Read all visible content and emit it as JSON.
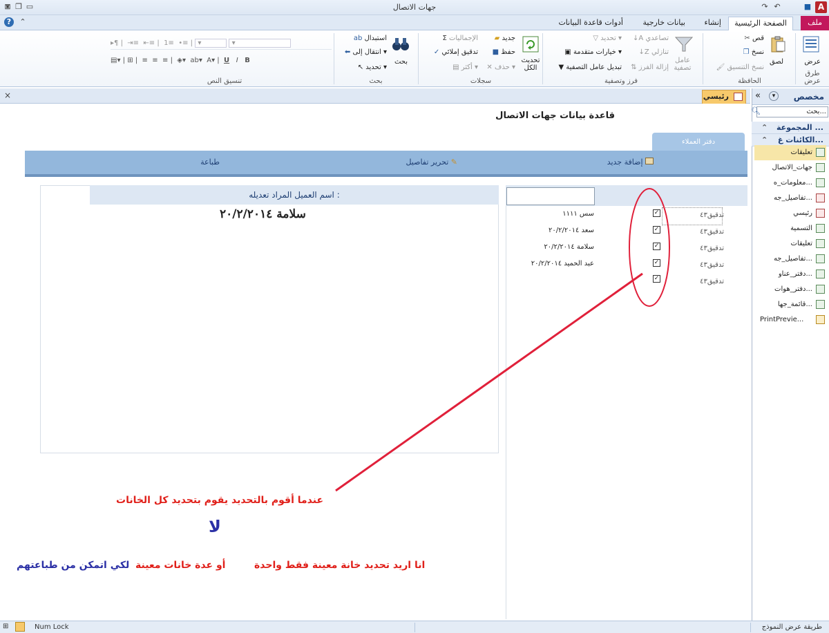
{
  "window": {
    "title": "جهات الاتصال",
    "logo": "A"
  },
  "ribbon_tabs": [
    {
      "label": "ملف"
    },
    {
      "label": "الصفحة الرئيسية"
    },
    {
      "label": "إنشاء"
    },
    {
      "label": "بيانات خارجية"
    },
    {
      "label": "أدوات قاعدة البيانات"
    }
  ],
  "groups": {
    "views": {
      "label": "طرق عرض",
      "view_btn": "عرض"
    },
    "clipboard": {
      "label": "الحافظة",
      "paste": "لصق",
      "cut": "قص",
      "copy": "نسخ",
      "format_painter": "نسخ التنسيق"
    },
    "sort_filter": {
      "label": "فرز وتصفية",
      "filter": "عامل تصفية",
      "ascending": "تصاعدي",
      "descending": "تنازلي",
      "remove_sort": "إزالة الفرز",
      "selection": "تحديد",
      "advanced": "خيارات متقدمة",
      "toggle_filter": "تبديل عامل التصفية"
    },
    "records": {
      "label": "سجلات",
      "refresh": "تحديث الكل",
      "new": "جديد",
      "save": "حفظ",
      "delete": "حذف",
      "totals": "الإجماليات",
      "spelling": "تدقيق إملائي",
      "more": "أكثر"
    },
    "find": {
      "label": "بحث",
      "find": "بحث",
      "replace": "استبدال",
      "goto": "انتقال إلى",
      "select": "تحديد"
    },
    "text_format": {
      "label": "تنسيق النص"
    }
  },
  "nav": {
    "header": "مخصص",
    "search_placeholder": "بحث...",
    "group1": "المجموعة ...",
    "group2": "الكائنات غ...",
    "items": [
      {
        "label": "تعليقات",
        "icon": "form-icon"
      },
      {
        "label": "جهات_الاتصال",
        "icon": "form-icon"
      },
      {
        "label": "معلومات_ه...",
        "icon": "form-icon"
      },
      {
        "label": "تفاصيل_جه...",
        "icon": "report-icon"
      },
      {
        "label": "رئيسي",
        "icon": "report-icon"
      },
      {
        "label": "التسمية",
        "icon": "report-icon"
      },
      {
        "label": "تعليقات",
        "icon": "report-icon"
      },
      {
        "label": "تفاصيل_جه...",
        "icon": "report-icon"
      },
      {
        "label": "دفتر_عناو...",
        "icon": "report-icon"
      },
      {
        "label": "دفتر_هوات...",
        "icon": "report-icon"
      },
      {
        "label": "قائمة_جها...",
        "icon": "report-icon"
      },
      {
        "label": "PrintPrevie...",
        "icon": "macro-icon"
      }
    ]
  },
  "doc_tab": "رئيسي",
  "form": {
    "title": "قاعدة بيانات جهات الاتصال",
    "subtab": "دفتر العملاء",
    "actions": {
      "add": "إضافة جديد",
      "edit": "تحرير تفاصيل",
      "print": "طباعة"
    },
    "edit_header": "اسم العميل المراد تعديله :",
    "edit_value": "سلامة ٢٠/٢/٢٠١٤",
    "rows": [
      {
        "code": "تدقيق٤٣",
        "name": "سس ١١١١",
        "checked": true
      },
      {
        "code": "تدقيق٤٣",
        "name": "سعد ٢٠/٢/٢٠١٤",
        "checked": true
      },
      {
        "code": "تدقيق٤٣",
        "name": "سلامة ٢٠/٢/٢٠١٤",
        "checked": true
      },
      {
        "code": "تدقيق٤٣",
        "name": "عبد الحميد ٢٠/٢/٢٠١٤",
        "checked": true
      },
      {
        "code": "تدقيق٤٣",
        "name": "",
        "checked": true
      }
    ]
  },
  "annotations": {
    "line1": "عندما أقوم بالتحديد يقوم بتحديد كل الخانات",
    "no": "لا",
    "line2a": "انا اريد تحديد خانة معينة فقط واحدة",
    "line2b": "أو عدة خانات معينة",
    "line2c": "لكي اتمكن من طباعتهم"
  },
  "status": {
    "view": "طريقة عرض النموذج",
    "numlock": "Num Lock"
  },
  "colors": {
    "file_tab": "#c2185b",
    "accent_bar": "#93b7dc",
    "annotation_red": "#e0201a",
    "annotation_blue": "#2a2fa5",
    "doc_tab": "#f7c96b"
  }
}
